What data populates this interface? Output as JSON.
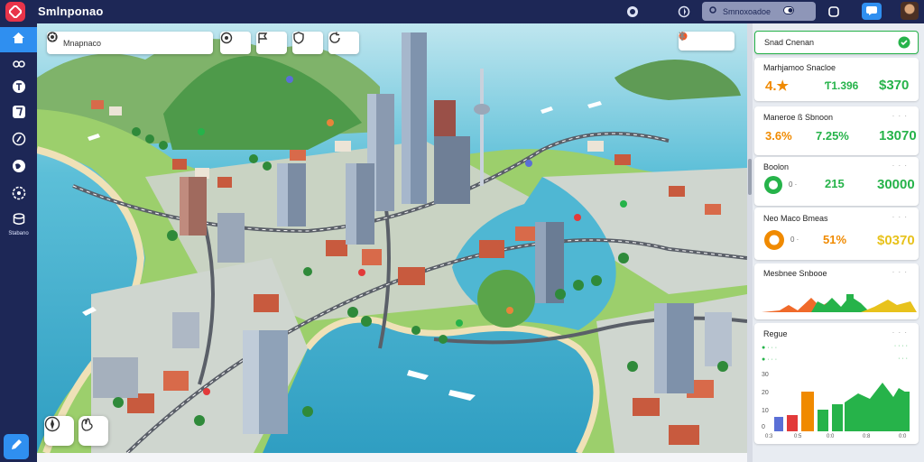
{
  "app": {
    "title": "Smlnponao"
  },
  "topbar": {
    "search_label": "Smnoxoadoe",
    "search_icon": "search-icon",
    "notif_icon": "chat-icon"
  },
  "sidebar": {
    "items": [
      {
        "icon": "home-icon"
      },
      {
        "icon": "link-icon"
      },
      {
        "icon": "tag-icon"
      },
      {
        "icon": "layers-icon"
      },
      {
        "icon": "compass-icon"
      },
      {
        "icon": "globe-icon"
      },
      {
        "icon": "settings-icon"
      },
      {
        "icon": "db-icon",
        "label": "Stabano"
      }
    ]
  },
  "map": {
    "search_label": "Mnapnaco",
    "toolbar_icons": [
      "gear-icon",
      "target-icon",
      "flag-icon",
      "shield-icon",
      "refresh-icon"
    ]
  },
  "panel": {
    "header": {
      "title": "Snad Cnenan"
    },
    "card1": {
      "title": "Marhjamoo Snacloe",
      "v1": "4.★",
      "v2": "Ƭ1.396",
      "v3": "$370"
    },
    "card2": {
      "title": "Maneroe ß Sbnoon",
      "dots": "· · ·",
      "v1": "3.6%",
      "v2": "7.25%",
      "v3": "13070"
    },
    "card3": {
      "title": "Boolon",
      "dots": "· · ·",
      "badge": "0 ·",
      "v2": "215",
      "v3": "30000"
    },
    "card4": {
      "title": "Neo Maco Bmeas",
      "dots": "· · ·",
      "badge": "0 ·",
      "v2": "51%",
      "v3": "$0370"
    },
    "card5": {
      "title": "Mesbnee Snbooe",
      "dots": "· · ·"
    },
    "card6": {
      "title": "Regue",
      "dots": "· · ·",
      "legend1": "· · ·",
      "legend2": "· · ·",
      "y_ticks": [
        "30",
        "20",
        "10",
        "0"
      ],
      "x_ticks": [
        "0:3",
        "0:5",
        "0:0",
        "0:8",
        "0:0"
      ]
    },
    "colors": {
      "green": "#26b34a",
      "orange": "#f08a00",
      "red": "#e23a3a",
      "yellow": "#e8c21c"
    }
  }
}
